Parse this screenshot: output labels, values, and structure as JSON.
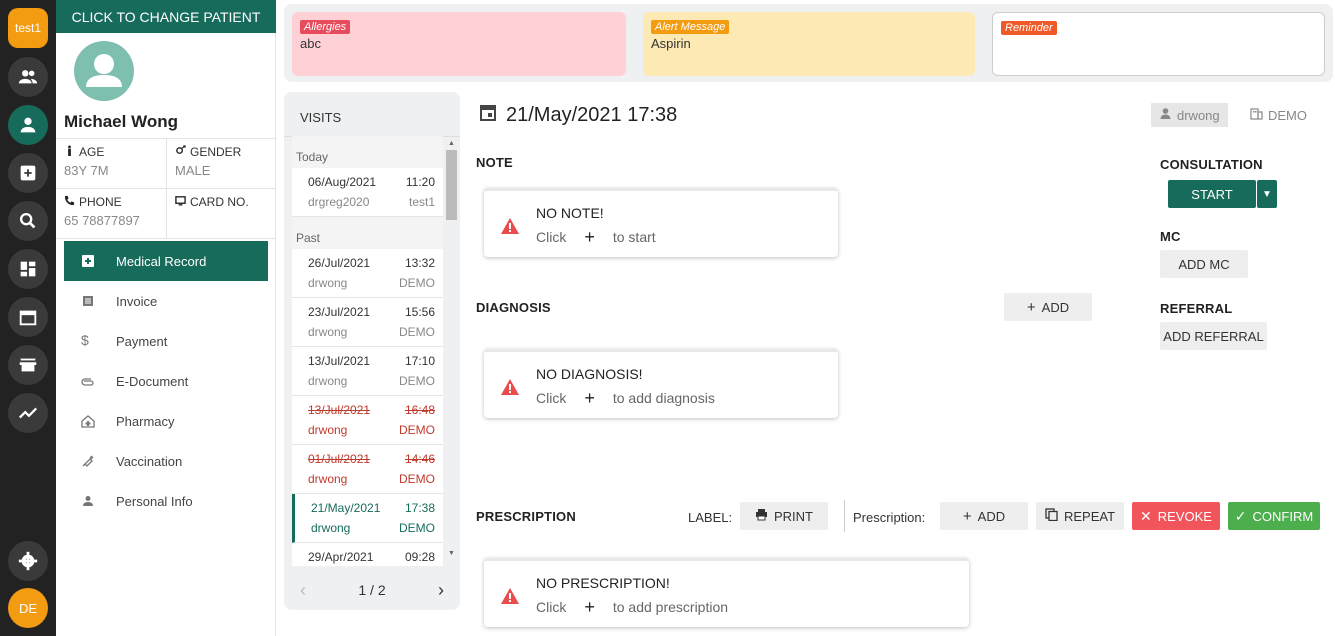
{
  "rail": {
    "user_badge": "test1",
    "avatar_initials": "DE"
  },
  "patient": {
    "change_label": "CLICK TO CHANGE PATIENT",
    "name": "Michael Wong",
    "age_label": "AGE",
    "age": "83Y 7M",
    "gender_label": "GENDER",
    "gender": "MALE",
    "phone_label": "PHONE",
    "phone": "65 78877897",
    "card_label": "CARD NO.",
    "card": ""
  },
  "menu": [
    {
      "label": "Medical Record",
      "icon": "plus-box-icon",
      "active": true
    },
    {
      "label": "Invoice",
      "icon": "list-icon"
    },
    {
      "label": "Payment",
      "icon": "dollar-icon"
    },
    {
      "label": "E-Document",
      "icon": "paperclip-icon"
    },
    {
      "label": "Pharmacy",
      "icon": "pharmacy-icon"
    },
    {
      "label": "Vaccination",
      "icon": "syringe-icon"
    },
    {
      "label": "Personal Info",
      "icon": "person-icon"
    }
  ],
  "alerts": {
    "allergies": {
      "tag": "Allergies",
      "text": "abc",
      "bg": "#ffd1d6",
      "tag_color": "#e74c5c"
    },
    "alert_message": {
      "tag": "Alert Message",
      "text": "Aspirin",
      "bg": "#fde9b3",
      "tag_color": "#f39c12"
    },
    "reminder": {
      "tag": "Reminder",
      "text": "",
      "bg": "#ffffff",
      "tag_color": "#f05a28"
    }
  },
  "visits": {
    "title": "VISITS",
    "today_label": "Today",
    "past_label": "Past",
    "today": [
      {
        "date": "06/Aug/2021",
        "time": "11:20",
        "doctor": "drgreg2020",
        "clinic": "test1"
      }
    ],
    "past": [
      {
        "date": "26/Jul/2021",
        "time": "13:32",
        "doctor": "drwong",
        "clinic": "DEMO"
      },
      {
        "date": "23/Jul/2021",
        "time": "15:56",
        "doctor": "drwong",
        "clinic": "DEMO"
      },
      {
        "date": "13/Jul/2021",
        "time": "17:10",
        "doctor": "drwong",
        "clinic": "DEMO"
      },
      {
        "date": "13/Jul/2021",
        "time": "16:48",
        "doctor": "drwong",
        "clinic": "DEMO",
        "void": true
      },
      {
        "date": "01/Jul/2021",
        "time": "14:46",
        "doctor": "drwong",
        "clinic": "DEMO",
        "void": true
      },
      {
        "date": "21/May/2021",
        "time": "17:38",
        "doctor": "drwong",
        "clinic": "DEMO",
        "selected": true
      },
      {
        "date": "29/Apr/2021",
        "time": "09:28",
        "doctor": "",
        "clinic": ""
      }
    ],
    "page": "1 / 2"
  },
  "visit": {
    "datetime": "21/May/2021 17:38",
    "doctor": "drwong",
    "clinic": "DEMO"
  },
  "note": {
    "title": "NOTE",
    "empty_title": "NO NOTE!",
    "click": "Click",
    "suffix": "to start"
  },
  "diagnosis": {
    "title": "DIAGNOSIS",
    "add_label": "ADD",
    "empty_title": "NO DIAGNOSIS!",
    "click": "Click",
    "suffix": "to add diagnosis"
  },
  "prescription": {
    "title": "PRESCRIPTION",
    "label_text": "LABEL:",
    "print_label": "PRINT",
    "prescription_text": "Prescription:",
    "add_label": "ADD",
    "repeat_label": "REPEAT",
    "revoke_label": "REVOKE",
    "confirm_label": "CONFIRM",
    "empty_title": "NO PRESCRIPTION!",
    "click": "Click",
    "suffix": "to add prescription"
  },
  "side": {
    "consultation_title": "CONSULTATION",
    "start_label": "START",
    "mc_title": "MC",
    "add_mc_label": "ADD MC",
    "referral_title": "REFERRAL",
    "add_referral_label": "ADD REFERRAL"
  },
  "colors": {
    "primary": "#176b5b",
    "danger": "#f2545b",
    "success": "#4cae4c",
    "rail": "#222222",
    "accent": "#f39c12"
  }
}
